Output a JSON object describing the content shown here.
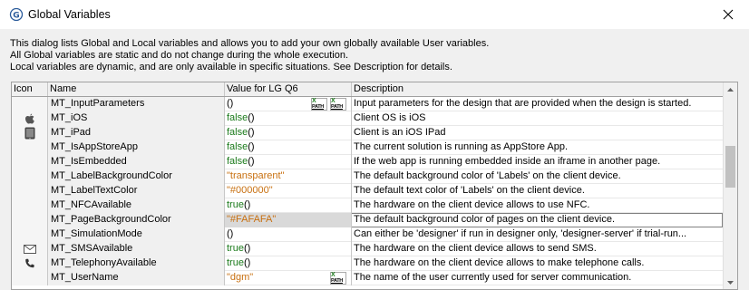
{
  "window": {
    "title": "Global Variables"
  },
  "intro": {
    "line1": "This dialog lists Global and Local variables and allows you to add your own globally available User variables.",
    "line2": "All Global variables are static and do not change during the whole execution.",
    "line3": "Local variables are dynamic, and are only available in specific situations. See Description for details."
  },
  "columns": {
    "icon": "Icon",
    "name": "Name",
    "value": "Value for LG Q6",
    "desc": "Description"
  },
  "rows": [
    {
      "icon": "",
      "name": "MT_InputParameters",
      "value": "()",
      "vtype": "plain",
      "xpath": true,
      "desc": "Input parameters for the design that are provided when the design is started."
    },
    {
      "icon": "apple-icon",
      "name": "MT_iOS",
      "value": "false()",
      "vtype": "func",
      "desc": "Client OS is iOS"
    },
    {
      "icon": "ipad-icon",
      "name": "MT_iPad",
      "value": "false()",
      "vtype": "func",
      "desc": "Client is an iOS IPad"
    },
    {
      "icon": "",
      "name": "MT_IsAppStoreApp",
      "value": "false()",
      "vtype": "func",
      "desc": "The current solution is running as AppStore App."
    },
    {
      "icon": "",
      "name": "MT_IsEmbedded",
      "value": "false()",
      "vtype": "func",
      "desc": "If the web app is running embedded inside an iframe in another page."
    },
    {
      "icon": "",
      "name": "MT_LabelBackgroundColor",
      "value": "\"transparent\"",
      "vtype": "str",
      "desc": "The default background color of 'Labels' on the client device."
    },
    {
      "icon": "",
      "name": "MT_LabelTextColor",
      "value": "\"#000000\"",
      "vtype": "str",
      "desc": "The default text color of 'Labels' on the client device."
    },
    {
      "icon": "",
      "name": "MT_NFCAvailable",
      "value": "true()",
      "vtype": "func",
      "desc": "The hardware on the client device allows to use NFC."
    },
    {
      "icon": "",
      "name": "MT_PageBackgroundColor",
      "value": "\"#FAFAFA\"",
      "vtype": "str",
      "selected": true,
      "desc": "The default background color of pages on the client device."
    },
    {
      "icon": "",
      "name": "MT_SimulationMode",
      "value": "()",
      "vtype": "plain",
      "desc": "Can either be 'designer' if run in designer only, 'designer-server' if trial-run..."
    },
    {
      "icon": "envelope-icon",
      "name": "MT_SMSAvailable",
      "value": "true()",
      "vtype": "func",
      "desc": "The hardware on the client device allows to send SMS."
    },
    {
      "icon": "phone-icon",
      "name": "MT_TelephonyAvailable",
      "value": "true()",
      "vtype": "func",
      "desc": "The hardware on the client device allows to make telephone calls."
    },
    {
      "icon": "",
      "name": "MT_UserName",
      "value": "\"dgm\"",
      "vtype": "str",
      "xpath": true,
      "desc": "The name of the user currently used for server communication."
    }
  ],
  "xpath_button": {
    "top": "X",
    "bottom": "PATH"
  },
  "colors": {
    "func": "#1a7a1a",
    "string": "#c87010",
    "selection": "#d9d9d9"
  }
}
